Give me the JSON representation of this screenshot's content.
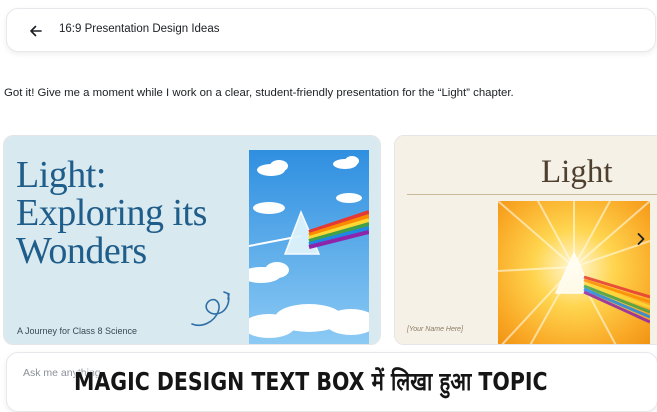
{
  "header": {
    "back_icon": "arrow-left-icon",
    "title": "16:9 Presentation Design Ideas"
  },
  "status_message": "Got it! Give me a moment while I work on a clear, student-friendly presentation for the “Light” chapter.",
  "designs": [
    {
      "title": "Light: Exploring its Wonders",
      "subtitle": "A Journey for Class 8 Science",
      "accent": "#1f5d8a"
    },
    {
      "title": "Light",
      "footer": "[Your Name Here]",
      "accent": "#4e3f2f"
    }
  ],
  "carousel": {
    "next_icon": "chevron-right-icon"
  },
  "ask_box": {
    "placeholder": "Ask me anything"
  },
  "overlay_caption": "MAGIC DESIGN TEXT BOX में लिखा हुआ TOPIC"
}
